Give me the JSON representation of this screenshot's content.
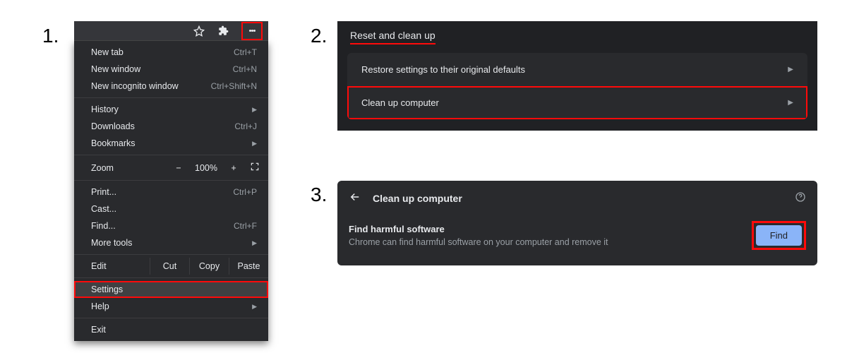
{
  "steps": {
    "one": "1.",
    "two": "2.",
    "three": "3."
  },
  "menu": {
    "newTab": "New tab",
    "newTabKey": "Ctrl+T",
    "newWindow": "New window",
    "newWindowKey": "Ctrl+N",
    "incognito": "New incognito window",
    "incognitoKey": "Ctrl+Shift+N",
    "history": "History",
    "downloads": "Downloads",
    "downloadsKey": "Ctrl+J",
    "bookmarks": "Bookmarks",
    "zoomLabel": "Zoom",
    "zoomMinus": "−",
    "zoomVal": "100%",
    "zoomPlus": "+",
    "print": "Print...",
    "printKey": "Ctrl+P",
    "cast": "Cast...",
    "find": "Find...",
    "findKey": "Ctrl+F",
    "moreTools": "More tools",
    "edit": "Edit",
    "cut": "Cut",
    "copy": "Copy",
    "paste": "Paste",
    "settings": "Settings",
    "help": "Help",
    "exit": "Exit"
  },
  "step2": {
    "sectionTitle": "Reset and clean up",
    "row1": "Restore settings to their original defaults",
    "row2": "Clean up computer"
  },
  "step3": {
    "title": "Clean up computer",
    "heading": "Find harmful software",
    "desc": "Chrome can find harmful software on your computer and remove it",
    "findBtn": "Find"
  }
}
